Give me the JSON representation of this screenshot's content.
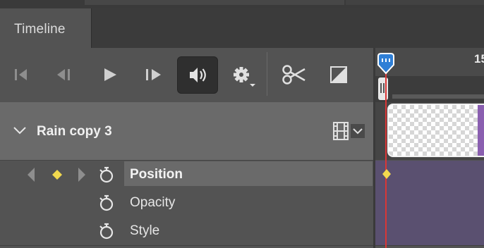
{
  "panel": {
    "tab_label": "Timeline"
  },
  "toolbar": {
    "buttons": [
      {
        "name": "go-to-first-frame",
        "icon": "skip-to-start-icon"
      },
      {
        "name": "previous-frame",
        "icon": "step-back-icon"
      },
      {
        "name": "play",
        "icon": "play-icon"
      },
      {
        "name": "next-frame",
        "icon": "step-forward-icon"
      },
      {
        "name": "audio",
        "icon": "speaker-icon",
        "active": true
      },
      {
        "name": "settings",
        "icon": "gear-icon"
      },
      {
        "name": "split-at-playhead",
        "icon": "scissors-icon"
      },
      {
        "name": "transition",
        "icon": "transition-icon"
      }
    ]
  },
  "layer": {
    "name": "Rain copy 3",
    "expanded": true,
    "type_icon": "film-strip-icon"
  },
  "properties": [
    {
      "label": "Position",
      "selected": true,
      "has_keyframe": true
    },
    {
      "label": "Opacity",
      "selected": false,
      "has_keyframe": false
    },
    {
      "label": "Style",
      "selected": false,
      "has_keyframe": false
    }
  ],
  "ruler": {
    "visible_number": "15"
  },
  "colors": {
    "panel_bg": "#535353",
    "layer_row_bg": "#6a6a6a",
    "playhead": "#d93636",
    "playhead_handle": "#2f7fd6",
    "keyframe": "#f2d94e",
    "track_purple": "#5a5070",
    "clip_edge_purple": "#8a5fb0"
  }
}
